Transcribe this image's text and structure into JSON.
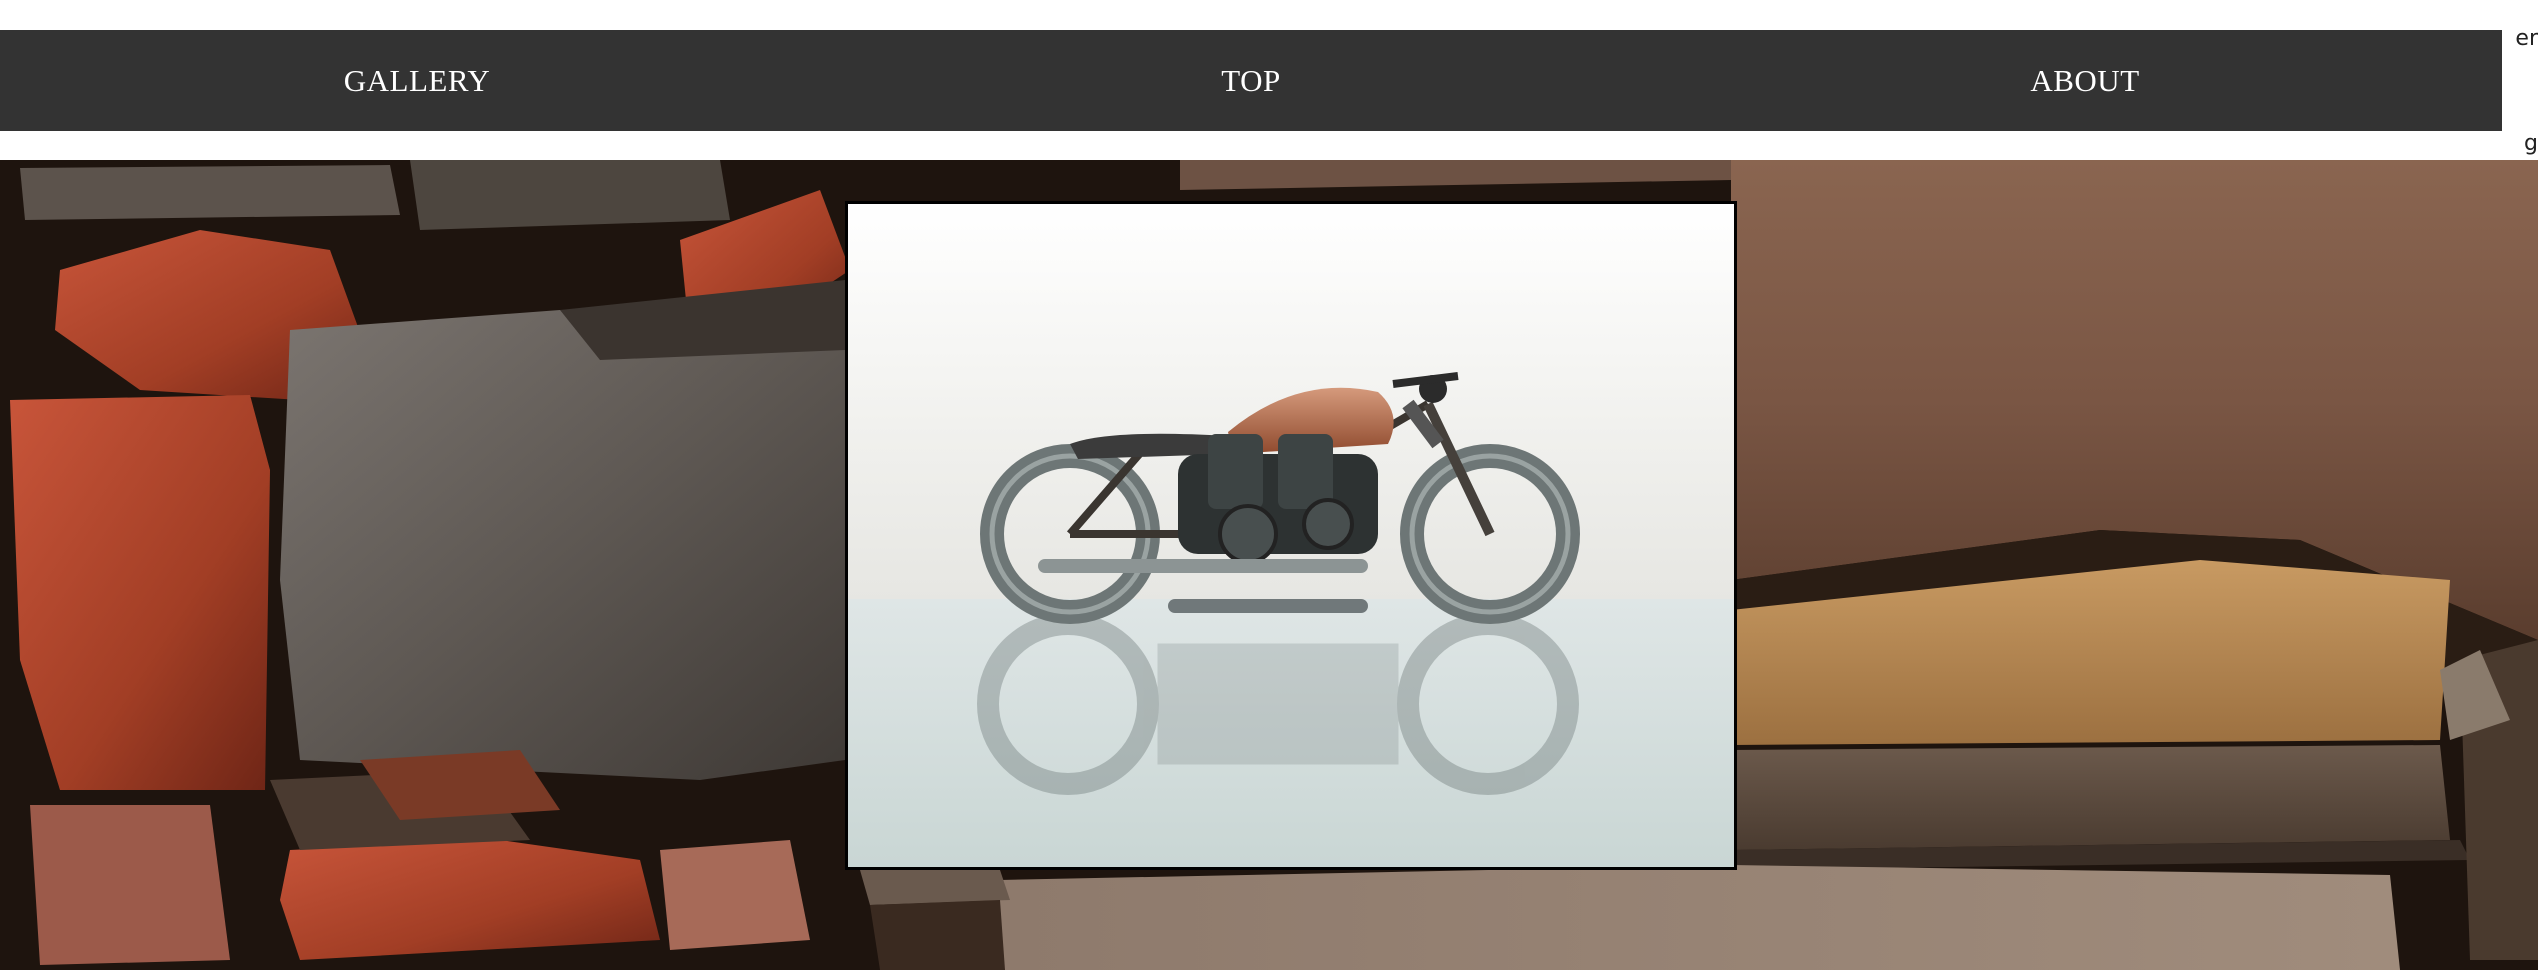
{
  "nav": {
    "items": [
      {
        "label": "GALLERY"
      },
      {
        "label": "TOP"
      },
      {
        "label": "ABOUT"
      }
    ]
  },
  "edge_overflow": {
    "line1": "er",
    "line2": "g"
  },
  "hero": {
    "background": "stone-wall-photo",
    "featured_image": "metal-sculpture-motorcycle-photo"
  },
  "colors": {
    "navbar_bg": "#333333",
    "nav_text": "#ffffff",
    "page_bg": "#ffffff"
  }
}
